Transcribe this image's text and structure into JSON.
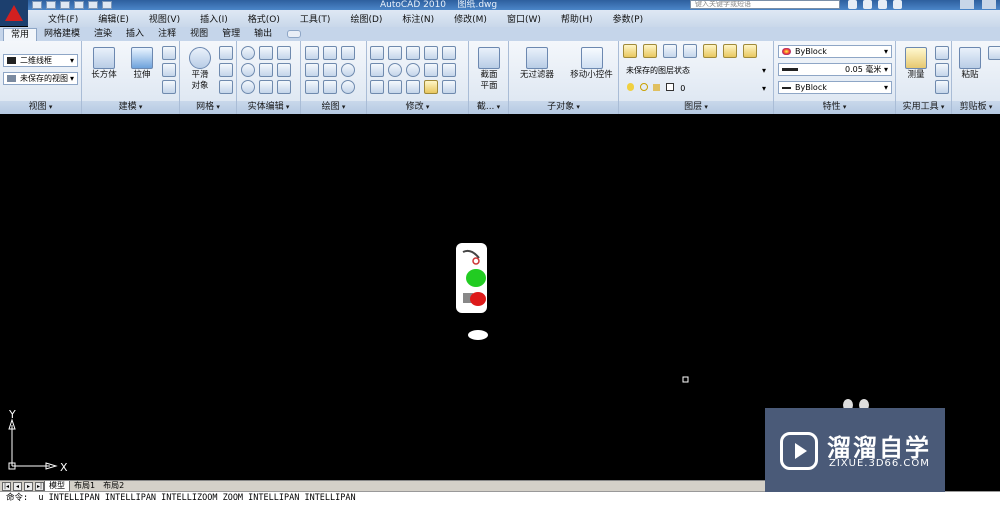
{
  "titlebar": {
    "title": "AutoCAD 2010    图纸.dwg",
    "search_placeholder": "键入关键字或短语"
  },
  "menu": [
    "文件(F)",
    "编辑(E)",
    "视图(V)",
    "插入(I)",
    "格式(O)",
    "工具(T)",
    "绘图(D)",
    "标注(N)",
    "修改(M)",
    "窗口(W)",
    "帮助(H)",
    "参数(P)"
  ],
  "tabs": [
    "常用",
    "网格建模",
    "渲染",
    "插入",
    "注释",
    "视图",
    "管理",
    "输出"
  ],
  "ribbon": {
    "view_panel": {
      "visual_style": "二维线框",
      "saved_view": "未保存的视图",
      "title": "视图"
    },
    "modeling_panel": {
      "box": "长方体",
      "extrude": "拉伸",
      "title": "建模"
    },
    "mesh_panel": {
      "smooth_line1": "平滑",
      "smooth_line2": "对象",
      "title": "网格"
    },
    "solid_edit_panel": {
      "title": "实体编辑"
    },
    "draw_panel": {
      "title": "绘图"
    },
    "modify_panel": {
      "title": "修改"
    },
    "section_panel": {
      "plane_line1": "截面",
      "plane_line2": "平面",
      "title": "截..."
    },
    "subobject_panel": {
      "filter": "无过滤器",
      "gizmo": "移动小控件",
      "title": "子对象"
    },
    "layers_panel": {
      "layer_state": "未保存的图层状态",
      "current_layer": "0",
      "title": "图层"
    },
    "properties_panel": {
      "color": "ByBlock",
      "lineweight": "0.05 毫米",
      "linetype": "ByBlock",
      "title": "特性"
    },
    "utilities_panel": {
      "measure": "测量",
      "title": "实用工具"
    },
    "clipboard_panel": {
      "paste": "粘贴",
      "title": "剪贴板"
    }
  },
  "ucs": {
    "x_label": "X",
    "y_label": "Y"
  },
  "layout_tabs": [
    "模型",
    "布局1",
    "布局2"
  ],
  "command_line": "命令:  u INTELLIPAN INTELLIPAN INTELLIZOOM ZOOM INTELLIPAN INTELLIPAN",
  "watermark": {
    "brand": "溜溜自学",
    "url": "ZIXUE.3D66.COM"
  },
  "colors": {
    "ribbon_bg": "#dbe5f1",
    "canvas_bg": "#000000",
    "accent": "#2e5f9e",
    "watermark_bg": "#4a5a78"
  }
}
